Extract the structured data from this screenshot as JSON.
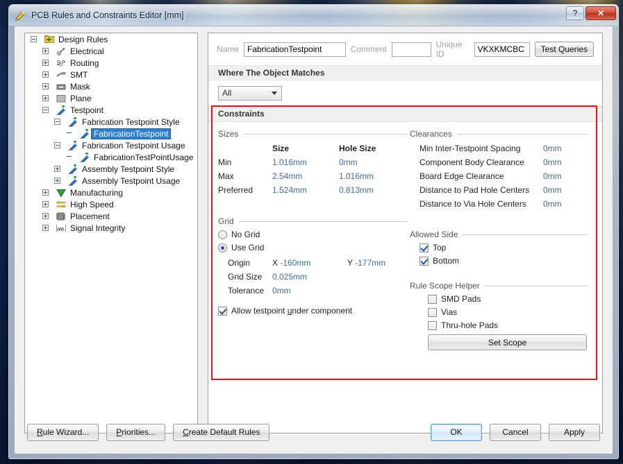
{
  "window": {
    "title": "PCB Rules and Constraints Editor [mm]",
    "app_icon": "pcb-rules-icon",
    "help_label": "?",
    "close_label": "✕"
  },
  "tree": {
    "items": [
      {
        "label": "Design Rules",
        "depth": 0,
        "expander": "minus",
        "icon": "design-rules-icon",
        "selected": false
      },
      {
        "label": "Electrical",
        "depth": 1,
        "expander": "plus",
        "icon": "electrical-icon",
        "selected": false
      },
      {
        "label": "Routing",
        "depth": 1,
        "expander": "plus",
        "icon": "routing-icon",
        "selected": false
      },
      {
        "label": "SMT",
        "depth": 1,
        "expander": "plus",
        "icon": "smt-icon",
        "selected": false
      },
      {
        "label": "Mask",
        "depth": 1,
        "expander": "plus",
        "icon": "mask-icon",
        "selected": false
      },
      {
        "label": "Plane",
        "depth": 1,
        "expander": "plus",
        "icon": "plane-icon",
        "selected": false
      },
      {
        "label": "Testpoint",
        "depth": 1,
        "expander": "minus",
        "icon": "testpoint-icon",
        "selected": false
      },
      {
        "label": "Fabrication Testpoint Style",
        "depth": 2,
        "expander": "minus",
        "icon": "testpoint-icon",
        "selected": false
      },
      {
        "label": "FabricationTestpoint",
        "depth": 3,
        "expander": "none",
        "icon": "testpoint-icon",
        "selected": true
      },
      {
        "label": "Fabrication Testpoint Usage",
        "depth": 2,
        "expander": "minus",
        "icon": "testpoint-icon",
        "selected": false
      },
      {
        "label": "FabricationTestPointUsage",
        "depth": 3,
        "expander": "none",
        "icon": "testpoint-icon",
        "selected": false
      },
      {
        "label": "Assembly Testpoint Style",
        "depth": 2,
        "expander": "plus",
        "icon": "testpoint-icon",
        "selected": false
      },
      {
        "label": "Assembly Testpoint Usage",
        "depth": 2,
        "expander": "plus",
        "icon": "testpoint-icon",
        "selected": false
      },
      {
        "label": "Manufacturing",
        "depth": 1,
        "expander": "plus",
        "icon": "manufacturing-icon",
        "selected": false
      },
      {
        "label": "High Speed",
        "depth": 1,
        "expander": "plus",
        "icon": "high-speed-icon",
        "selected": false
      },
      {
        "label": "Placement",
        "depth": 1,
        "expander": "plus",
        "icon": "placement-icon",
        "selected": false
      },
      {
        "label": "Signal Integrity",
        "depth": 1,
        "expander": "plus",
        "icon": "signal-integrity-icon",
        "selected": false
      }
    ]
  },
  "form": {
    "name_label": "Name",
    "name_value": "FabricationTestpoint",
    "comment_label": "Comment",
    "comment_value": "",
    "unique_id_label": "Unique ID",
    "unique_id_value": "VKXKMCBC",
    "test_queries_label": "Test Queries",
    "where_band": "Where The Object Matches",
    "scope_selected": "All"
  },
  "constraints": {
    "title": "Constraints",
    "sizes": {
      "group_label": "Sizes",
      "columns": [
        "",
        "Size",
        "Hole Size"
      ],
      "rows": [
        {
          "label": "Min",
          "size": "1.016mm",
          "hole_size": "0mm"
        },
        {
          "label": "Max",
          "size": "2.54mm",
          "hole_size": "1.016mm"
        },
        {
          "label": "Preferred",
          "size": "1.524mm",
          "hole_size": "0.813mm"
        }
      ]
    },
    "clearances": {
      "group_label": "Clearances",
      "rows": [
        {
          "label": "Min Inter-Testpoint Spacing",
          "value": "0mm"
        },
        {
          "label": "Component Body Clearance",
          "value": "0mm"
        },
        {
          "label": "Board Edge Clearance",
          "value": "0mm"
        },
        {
          "label": "Distance to Pad Hole Centers",
          "value": "0mm"
        },
        {
          "label": "Distance to Via Hole Centers",
          "value": "0mm"
        }
      ]
    },
    "grid": {
      "group_label": "Grid",
      "no_grid_label": "No Grid",
      "no_grid_checked": false,
      "use_grid_label": "Use Grid",
      "use_grid_checked": true,
      "origin_label": "Origin",
      "origin_x_prefix": "X",
      "origin_x_value": "-160mm",
      "origin_y_prefix": "Y",
      "origin_y_value": "-177mm",
      "grid_size_label": "Grid Size",
      "grid_size_value": "0.025mm",
      "tolerance_label": "Tolerance",
      "tolerance_value": "0mm",
      "allow_under_component_label": "Allow testpoint under component",
      "allow_under_component_checked": true
    },
    "allowed_side": {
      "group_label": "Allowed Side",
      "options": [
        {
          "label": "Top",
          "checked": true
        },
        {
          "label": "Bottom",
          "checked": true
        }
      ]
    },
    "rule_scope_helper": {
      "group_label": "Rule Scope Helper",
      "options": [
        {
          "label": "SMD Pads",
          "checked": false
        },
        {
          "label": "Vias",
          "checked": false
        },
        {
          "label": "Thru-hole Pads",
          "checked": false
        }
      ],
      "set_scope_label": "Set Scope"
    },
    "highlight_color": "#ee1111"
  },
  "footer": {
    "rule_wizard_label": "Rule Wizard...",
    "priorities_label": "Priorities...",
    "create_default_rules_label": "Create Default Rules",
    "ok_label": "OK",
    "cancel_label": "Cancel",
    "apply_label": "Apply"
  },
  "colors": {
    "value_blue": "#3a6ea5",
    "selection_blue": "#2a7fd4",
    "highlight_red": "#ee1111"
  }
}
